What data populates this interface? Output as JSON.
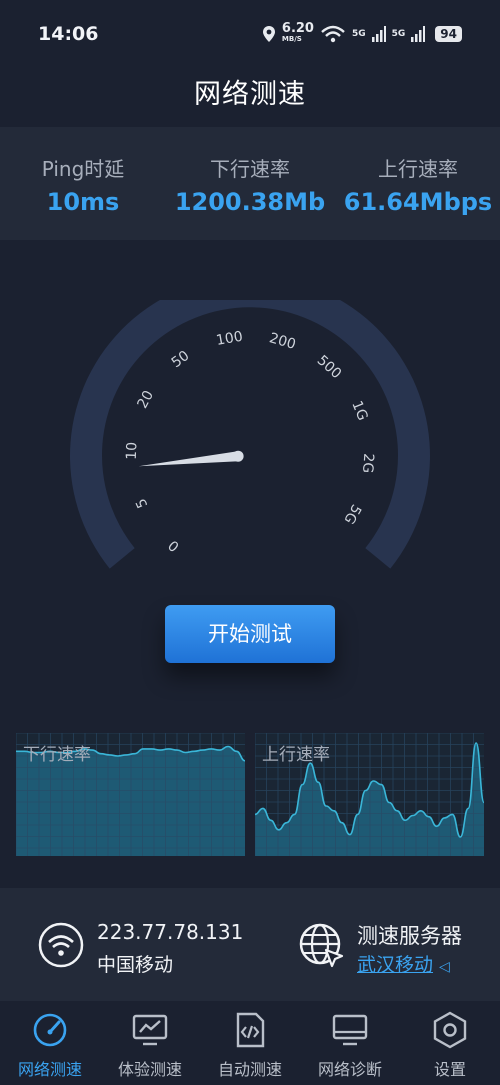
{
  "status_bar": {
    "time": "14:06",
    "net_speed_value": "6.20",
    "net_speed_unit": "MB/S",
    "signal_1": "5G",
    "signal_2": "5G",
    "battery": "94"
  },
  "app": {
    "title": "网络测速"
  },
  "stats": {
    "ping_label": "Ping时延",
    "ping_value": "10ms",
    "download_label": "下行速率",
    "download_value": "1200.38Mb",
    "upload_label": "上行速率",
    "upload_value": "61.64Mbps"
  },
  "gauge": {
    "ticks": [
      "0",
      "5",
      "10",
      "20",
      "50",
      "100",
      "200",
      "500",
      "1G",
      "2G",
      "5G"
    ],
    "needle_fraction": 0.17,
    "colors": {
      "track": "#28344f",
      "needle": "#d8dde5"
    }
  },
  "start_button": {
    "label": "开始测试"
  },
  "charts": {
    "download": {
      "label": "下行速率",
      "values": [
        0.88,
        0.88,
        0.87,
        0.87,
        0.88,
        0.87,
        0.87,
        0.88,
        0.9,
        0.89,
        0.86,
        0.85,
        0.84,
        0.85,
        0.86,
        0.9,
        0.9,
        0.89,
        0.9,
        0.89,
        0.87,
        0.88,
        0.89,
        0.9,
        0.89,
        0.92,
        0.88,
        0.8
      ]
    },
    "upload": {
      "label": "上行速率",
      "values": [
        0.35,
        0.4,
        0.3,
        0.22,
        0.28,
        0.35,
        0.6,
        0.78,
        0.62,
        0.42,
        0.38,
        0.28,
        0.18,
        0.35,
        0.55,
        0.63,
        0.6,
        0.45,
        0.38,
        0.3,
        0.34,
        0.38,
        0.33,
        0.25,
        0.32,
        0.35,
        0.16,
        0.4,
        0.95,
        0.45
      ]
    },
    "colors": {
      "fill": "#1e5a74",
      "line": "#3ab6d8",
      "grid": "#2a4a66"
    }
  },
  "network_info": {
    "ip": "223.77.78.131",
    "isp": "中国移动",
    "server_label": "测速服务器",
    "server_name": "武汉移动"
  },
  "nav": [
    {
      "label": "网络测速",
      "icon": "speedometer-icon",
      "active": true
    },
    {
      "label": "体验测速",
      "icon": "monitor-chart-icon",
      "active": false
    },
    {
      "label": "自动测速",
      "icon": "code-document-icon",
      "active": false
    },
    {
      "label": "网络诊断",
      "icon": "monitor-icon",
      "active": false
    },
    {
      "label": "设置",
      "icon": "settings-hexagon-icon",
      "active": false
    }
  ]
}
